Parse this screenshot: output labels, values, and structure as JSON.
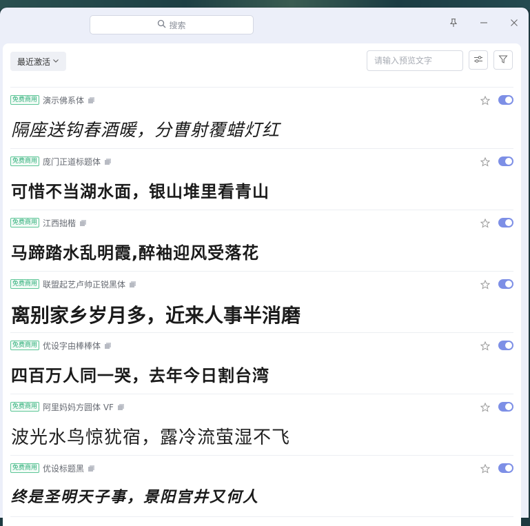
{
  "search": {
    "placeholder": "搜索"
  },
  "toolbar": {
    "category_label": "最近激活",
    "preview_placeholder": "请输入预览文字"
  },
  "fonts": [
    {
      "badge": "免费商用",
      "name": "演示佛系体",
      "sample": "隔座送钩春酒暖，分曹射覆蜡灯红",
      "enabled": true,
      "favorite": false
    },
    {
      "badge": "免费商用",
      "name": "庞门正道标题体",
      "sample": "可惜不当湖水面，银山堆里看青山",
      "enabled": true,
      "favorite": false
    },
    {
      "badge": "免费商用",
      "name": "江西拙楷",
      "sample": "马蹄踏水乱明霞,醉袖迎风受落花",
      "enabled": true,
      "favorite": false
    },
    {
      "badge": "免费商用",
      "name": "联盟起艺卢帅正锐黑体",
      "sample": "离别家乡岁月多，近来人事半消磨",
      "enabled": true,
      "favorite": false
    },
    {
      "badge": "免费商用",
      "name": "优设字由棒棒体",
      "sample": "四百万人同一哭，去年今日割台湾",
      "enabled": true,
      "favorite": false
    },
    {
      "badge": "免费商用",
      "name": "阿里妈妈方圆体 VF",
      "sample": "波光水鸟惊犹宿，露冷流萤湿不飞",
      "enabled": true,
      "favorite": false
    },
    {
      "badge": "免费商用",
      "name": "优设标题黑",
      "sample": "终是圣明天子事，景阳宫井又何人",
      "enabled": true,
      "favorite": false
    }
  ],
  "colors": {
    "accent": "#7d8fe6",
    "badge": "#2faf7a"
  }
}
